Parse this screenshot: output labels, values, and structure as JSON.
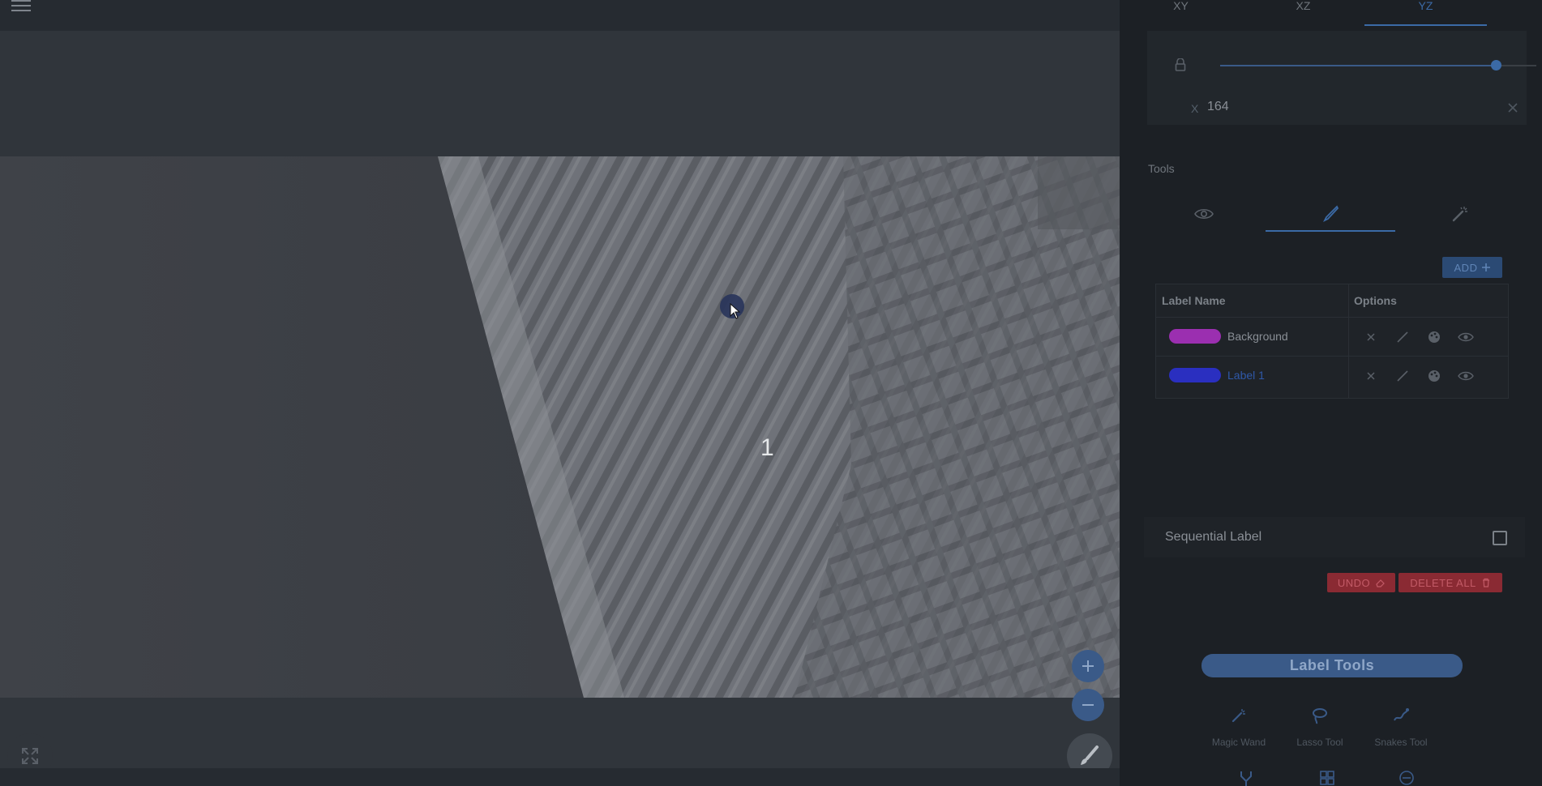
{
  "viewer": {
    "slice_label_marker": "1",
    "zoom_in_symbol": "+",
    "zoom_out_symbol": "−"
  },
  "panel": {
    "tabs": [
      {
        "label": "XY",
        "active": false
      },
      {
        "label": "XZ",
        "active": false
      },
      {
        "label": "YZ",
        "active": true
      }
    ],
    "slice": {
      "axis_prefix": "X",
      "value": "164"
    },
    "tools_title": "Tools",
    "tool_tabs": [
      "eye-icon",
      "brush-icon",
      "magic-wand-icon"
    ],
    "add_label": "ADD",
    "table": {
      "col_name": "Label Name",
      "col_options": "Options",
      "rows": [
        {
          "name": "Background",
          "color": "#9b2fb0",
          "selected": false
        },
        {
          "name": "Label 1",
          "color": "#2a2fc0",
          "selected": true
        }
      ]
    },
    "sequential_label": "Sequential Label",
    "undo_label": "UNDO",
    "delete_all_label": "DELETE ALL",
    "label_tools": {
      "title": "Label Tools",
      "items": [
        "Magic Wand",
        "Lasso Tool",
        "Snakes Tool"
      ]
    },
    "colors": {
      "accent": "#3b6aa6",
      "danger": "#8a2a33"
    }
  }
}
